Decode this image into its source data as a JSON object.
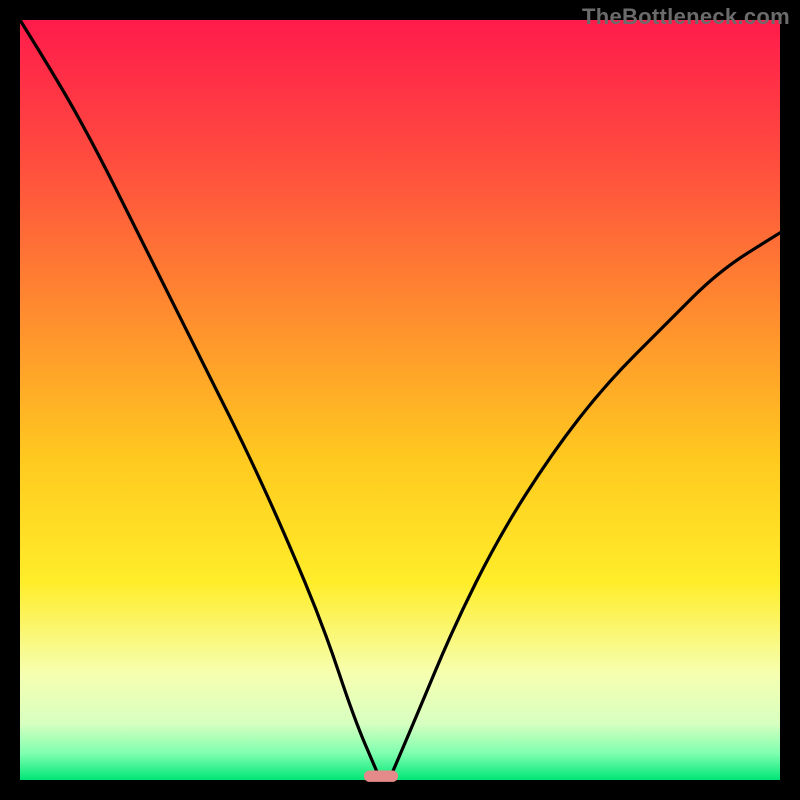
{
  "watermark": {
    "text": "TheBottleneck.com"
  },
  "chart_data": {
    "type": "line",
    "title": "",
    "xlabel": "",
    "ylabel": "",
    "xlim": [
      0,
      780
    ],
    "ylim": [
      0,
      780
    ],
    "bottleneck_point_x_fraction": 0.475,
    "left_curve_top_y_fraction": 1.0,
    "right_curve_top_y_fraction": 0.72,
    "notes": "Bottleneck-style V-curve. Y-axis is inverted visually (higher = worse). A left descending arc and a right ascending arc meet at the green zone at the bottom.",
    "series": [
      {
        "name": "left_curve",
        "points_normalized": [
          [
            0.0,
            1.0
          ],
          [
            0.05,
            0.92
          ],
          [
            0.1,
            0.83
          ],
          [
            0.15,
            0.73
          ],
          [
            0.2,
            0.63
          ],
          [
            0.25,
            0.53
          ],
          [
            0.3,
            0.43
          ],
          [
            0.35,
            0.32
          ],
          [
            0.4,
            0.2
          ],
          [
            0.44,
            0.08
          ],
          [
            0.47,
            0.01
          ]
        ]
      },
      {
        "name": "right_curve",
        "points_normalized": [
          [
            0.49,
            0.01
          ],
          [
            0.52,
            0.08
          ],
          [
            0.57,
            0.2
          ],
          [
            0.63,
            0.32
          ],
          [
            0.7,
            0.43
          ],
          [
            0.77,
            0.52
          ],
          [
            0.85,
            0.6
          ],
          [
            0.92,
            0.67
          ],
          [
            1.0,
            0.72
          ]
        ]
      }
    ],
    "marker": {
      "name": "bottleneck_marker",
      "shape": "pill",
      "color": "#e58a8a",
      "x_fraction": 0.475,
      "y_fraction": 0.005,
      "width_fraction": 0.045,
      "height_fraction": 0.015
    },
    "gradient_stops": [
      {
        "offset": 0.0,
        "color": "#ff1b4b"
      },
      {
        "offset": 0.18,
        "color": "#ff4b3f"
      },
      {
        "offset": 0.38,
        "color": "#ff8a2f"
      },
      {
        "offset": 0.58,
        "color": "#ffca1f"
      },
      {
        "offset": 0.74,
        "color": "#ffed2a"
      },
      {
        "offset": 0.86,
        "color": "#f6ffb0"
      },
      {
        "offset": 0.925,
        "color": "#d8ffc0"
      },
      {
        "offset": 0.965,
        "color": "#7fffaf"
      },
      {
        "offset": 1.0,
        "color": "#00e676"
      }
    ],
    "frame": {
      "stroke": "#000000",
      "stroke_width": 20,
      "inner_size": 780
    }
  }
}
